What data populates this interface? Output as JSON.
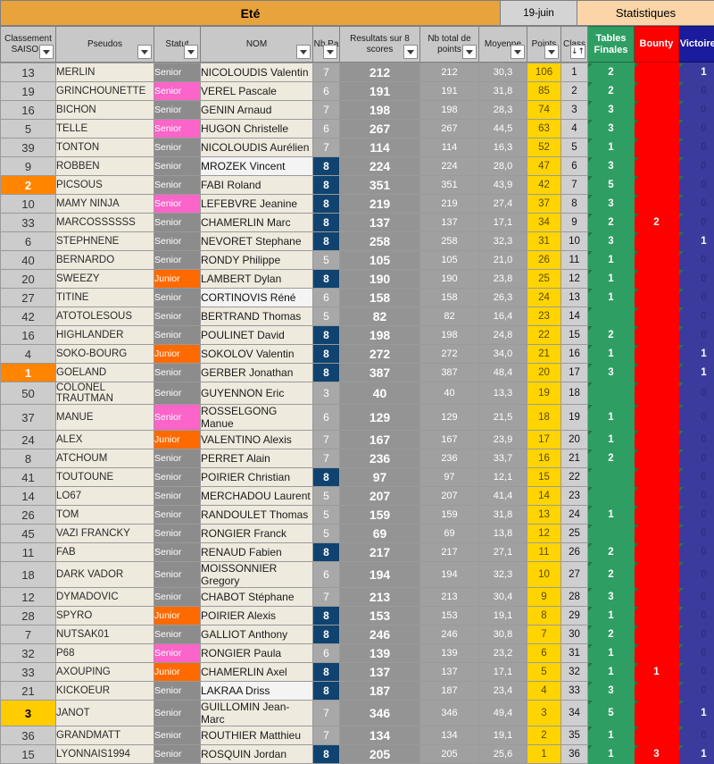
{
  "title_band": {
    "season": "Eté",
    "date": "19-juin",
    "stats": "Statistiques"
  },
  "columns": [
    {
      "key": "rank",
      "label": "Classement SAISON",
      "filter": "dropdown"
    },
    {
      "key": "pseudo",
      "label": "Pseudos",
      "filter": "dropdown"
    },
    {
      "key": "statut",
      "label": "Statut",
      "filter": "dropdown"
    },
    {
      "key": "nom",
      "label": "NOM",
      "filter": "dropdown"
    },
    {
      "key": "nbpa",
      "label": "Nb Pa",
      "filter": "dropdown"
    },
    {
      "key": "res8",
      "label": "Resultats sur 8 scores",
      "filter": "dropdown"
    },
    {
      "key": "nbtot",
      "label": "Nb total de points",
      "filter": "dropdown"
    },
    {
      "key": "moy",
      "label": "Moyenne",
      "filter": "dropdown"
    },
    {
      "key": "points",
      "label": "Points",
      "filter": "dropdown"
    },
    {
      "key": "class",
      "label": "Class",
      "filter": "sort-asc"
    },
    {
      "key": "tf",
      "label": "Tables Finales",
      "filter": "none"
    },
    {
      "key": "bounty",
      "label": "Bounty",
      "filter": "none"
    },
    {
      "key": "vic",
      "label": "Victoire(s)",
      "filter": "none"
    }
  ],
  "icons": {
    "filter_dropdown": "chevron-down-icon",
    "sort_ascending": "sort-ascending-icon",
    "comment_marker": "comment-indicator-icon"
  },
  "colors": {
    "season_band": "#e8a33d",
    "stats_band": "#fbd5a8",
    "tables_finales": "#2e9e63",
    "bounty": "#fe0000",
    "victoires": "#1b1b9e",
    "points": "#ffd400",
    "rank_first": "#ff8400",
    "rank_third": "#ffcc00",
    "statut_pink": "#fb64c8",
    "statut_orange": "#ff6a00",
    "nbpa_full": "#10436f"
  },
  "rows": [
    {
      "rank": "13",
      "rank_style": "none",
      "pseudo": "MERLIN",
      "statut": "Senior",
      "statut_style": "none",
      "nom": "NICOLOUDIS Valentin",
      "nom_style": "cream",
      "nbpa": "7",
      "nbpa_full": false,
      "res8": "212",
      "nbtot": "212",
      "moy": "30,3",
      "points": "106",
      "class": "1",
      "tf": "2",
      "bounty": "",
      "vic": "1"
    },
    {
      "rank": "19",
      "rank_style": "none",
      "pseudo": "GRINCHOUNETTE",
      "statut": "Senior",
      "statut_style": "pink",
      "nom": "VEREL Pascale",
      "nom_style": "cream",
      "nbpa": "6",
      "nbpa_full": false,
      "res8": "191",
      "nbtot": "191",
      "moy": "31,8",
      "points": "85",
      "class": "2",
      "tf": "2",
      "bounty": "",
      "vic": "0"
    },
    {
      "rank": "16",
      "rank_style": "none",
      "pseudo": "BICHON",
      "statut": "Senior",
      "statut_style": "none",
      "nom": "GENIN Arnaud",
      "nom_style": "cream",
      "nbpa": "7",
      "nbpa_full": false,
      "res8": "198",
      "nbtot": "198",
      "moy": "28,3",
      "points": "74",
      "class": "3",
      "tf": "3",
      "bounty": "",
      "vic": "0"
    },
    {
      "rank": "5",
      "rank_style": "none",
      "pseudo": "TELLE",
      "statut": "Senior",
      "statut_style": "pink",
      "nom": "HUGON Christelle",
      "nom_style": "cream",
      "nbpa": "6",
      "nbpa_full": false,
      "res8": "267",
      "nbtot": "267",
      "moy": "44,5",
      "points": "63",
      "class": "4",
      "tf": "3",
      "bounty": "",
      "vic": "0"
    },
    {
      "rank": "39",
      "rank_style": "none",
      "pseudo": "TONTON",
      "statut": "Senior",
      "statut_style": "none",
      "nom": "NICOLOUDIS Aurélien",
      "nom_style": "cream",
      "nbpa": "7",
      "nbpa_full": false,
      "res8": "114",
      "nbtot": "114",
      "moy": "16,3",
      "points": "52",
      "class": "5",
      "tf": "1",
      "bounty": "",
      "vic": "0"
    },
    {
      "rank": "9",
      "rank_style": "none",
      "pseudo": "ROBBEN",
      "statut": "Senior",
      "statut_style": "none",
      "nom": "MROZEK Vincent",
      "nom_style": "lite",
      "nbpa": "8",
      "nbpa_full": true,
      "res8": "224",
      "nbtot": "224",
      "moy": "28,0",
      "points": "47",
      "class": "6",
      "tf": "3",
      "bounty": "",
      "vic": "0"
    },
    {
      "rank": "2",
      "rank_style": "orange",
      "pseudo": "PICSOUS",
      "statut": "Senior",
      "statut_style": "none",
      "nom": "FABI Roland",
      "nom_style": "cream",
      "nbpa": "8",
      "nbpa_full": true,
      "res8": "351",
      "nbtot": "351",
      "moy": "43,9",
      "points": "42",
      "class": "7",
      "tf": "5",
      "bounty": "",
      "vic": "0"
    },
    {
      "rank": "10",
      "rank_style": "none",
      "pseudo": "MAMY NINJA",
      "statut": "Senior",
      "statut_style": "pink",
      "nom": "LEFEBVRE Jeanine",
      "nom_style": "cream",
      "nbpa": "8",
      "nbpa_full": true,
      "res8": "219",
      "nbtot": "219",
      "moy": "27,4",
      "points": "37",
      "class": "8",
      "tf": "3",
      "bounty": "",
      "vic": "0"
    },
    {
      "rank": "33",
      "rank_style": "none",
      "pseudo": "MARCOSSSSSS",
      "statut": "Senior",
      "statut_style": "none",
      "nom": "CHAMERLIN Marc",
      "nom_style": "cream",
      "nbpa": "8",
      "nbpa_full": true,
      "res8": "137",
      "nbtot": "137",
      "moy": "17,1",
      "points": "34",
      "class": "9",
      "tf": "2",
      "bounty": "2",
      "vic": "0"
    },
    {
      "rank": "6",
      "rank_style": "none",
      "pseudo": "STEPHNENE",
      "statut": "Senior",
      "statut_style": "none",
      "nom": "NEVORET Stephane",
      "nom_style": "cream",
      "nbpa": "8",
      "nbpa_full": true,
      "res8": "258",
      "nbtot": "258",
      "moy": "32,3",
      "points": "31",
      "class": "10",
      "tf": "3",
      "bounty": "",
      "vic": "1"
    },
    {
      "rank": "40",
      "rank_style": "none",
      "pseudo": "BERNARDO",
      "statut": "Senior",
      "statut_style": "none",
      "nom": "RONDY Philippe",
      "nom_style": "cream",
      "nbpa": "5",
      "nbpa_full": false,
      "res8": "105",
      "nbtot": "105",
      "moy": "21,0",
      "points": "26",
      "class": "11",
      "tf": "1",
      "bounty": "",
      "vic": "0"
    },
    {
      "rank": "20",
      "rank_style": "none",
      "pseudo": "SWEEZY",
      "statut": "Junior",
      "statut_style": "orange",
      "nom": "LAMBERT Dylan",
      "nom_style": "cream",
      "nbpa": "8",
      "nbpa_full": true,
      "res8": "190",
      "nbtot": "190",
      "moy": "23,8",
      "points": "25",
      "class": "12",
      "tf": "1",
      "bounty": "",
      "vic": "0"
    },
    {
      "rank": "27",
      "rank_style": "none",
      "pseudo": "TITINE",
      "statut": "Senior",
      "statut_style": "none",
      "nom": "CORTINOVIS Réné",
      "nom_style": "lite",
      "nbpa": "6",
      "nbpa_full": false,
      "res8": "158",
      "nbtot": "158",
      "moy": "26,3",
      "points": "24",
      "class": "13",
      "tf": "1",
      "bounty": "",
      "vic": "0"
    },
    {
      "rank": "42",
      "rank_style": "none",
      "pseudo": "ATOTOLESOUS",
      "statut": "Senior",
      "statut_style": "none",
      "nom": "BERTRAND Thomas",
      "nom_style": "cream",
      "nbpa": "5",
      "nbpa_full": false,
      "res8": "82",
      "nbtot": "82",
      "moy": "16,4",
      "points": "23",
      "class": "14",
      "tf": "",
      "bounty": "",
      "vic": "0"
    },
    {
      "rank": "16",
      "rank_style": "none",
      "pseudo": "HIGHLANDER",
      "statut": "Senior",
      "statut_style": "none",
      "nom": "POULINET David",
      "nom_style": "cream",
      "nbpa": "8",
      "nbpa_full": true,
      "res8": "198",
      "nbtot": "198",
      "moy": "24,8",
      "points": "22",
      "class": "15",
      "tf": "2",
      "bounty": "",
      "vic": "0"
    },
    {
      "rank": "4",
      "rank_style": "none",
      "pseudo": "SOKO-BOURG",
      "statut": "Junior",
      "statut_style": "orange",
      "nom": "SOKOLOV Valentin",
      "nom_style": "cream",
      "nbpa": "8",
      "nbpa_full": true,
      "res8": "272",
      "nbtot": "272",
      "moy": "34,0",
      "points": "21",
      "class": "16",
      "tf": "1",
      "bounty": "",
      "vic": "1"
    },
    {
      "rank": "1",
      "rank_style": "orange",
      "pseudo": "GOELAND",
      "statut": "Senior",
      "statut_style": "none",
      "nom": "GERBER Jonathan",
      "nom_style": "cream",
      "nbpa": "8",
      "nbpa_full": true,
      "res8": "387",
      "nbtot": "387",
      "moy": "48,4",
      "points": "20",
      "class": "17",
      "tf": "3",
      "bounty": "",
      "vic": "1"
    },
    {
      "rank": "50",
      "rank_style": "none",
      "pseudo": "COLONEL TRAUTMAN",
      "statut": "Senior",
      "statut_style": "none",
      "nom": "GUYENNON Eric",
      "nom_style": "cream",
      "nbpa": "3",
      "nbpa_full": false,
      "res8": "40",
      "nbtot": "40",
      "moy": "13,3",
      "points": "19",
      "class": "18",
      "tf": "",
      "bounty": "",
      "vic": "0"
    },
    {
      "rank": "37",
      "rank_style": "none",
      "pseudo": "MANUE",
      "statut": "Senior",
      "statut_style": "pink",
      "nom": "ROSSELGONG Manue",
      "nom_style": "cream",
      "nbpa": "6",
      "nbpa_full": false,
      "res8": "129",
      "nbtot": "129",
      "moy": "21,5",
      "points": "18",
      "class": "19",
      "tf": "1",
      "bounty": "",
      "vic": "0"
    },
    {
      "rank": "24",
      "rank_style": "none",
      "pseudo": "ALEX",
      "statut": "Junior",
      "statut_style": "orange",
      "nom": "VALENTINO Alexis",
      "nom_style": "cream",
      "nbpa": "7",
      "nbpa_full": false,
      "res8": "167",
      "nbtot": "167",
      "moy": "23,9",
      "points": "17",
      "class": "20",
      "tf": "1",
      "bounty": "",
      "vic": "0"
    },
    {
      "rank": "8",
      "rank_style": "none",
      "pseudo": "ATCHOUM",
      "statut": "Senior",
      "statut_style": "none",
      "nom": "PERRET Alain",
      "nom_style": "cream",
      "nbpa": "7",
      "nbpa_full": false,
      "res8": "236",
      "nbtot": "236",
      "moy": "33,7",
      "points": "16",
      "class": "21",
      "tf": "2",
      "bounty": "",
      "vic": "0"
    },
    {
      "rank": "41",
      "rank_style": "none",
      "pseudo": "TOUTOUNE",
      "statut": "Senior",
      "statut_style": "none",
      "nom": "POIRIER Christian",
      "nom_style": "cream",
      "nbpa": "8",
      "nbpa_full": true,
      "res8": "97",
      "nbtot": "97",
      "moy": "12,1",
      "points": "15",
      "class": "22",
      "tf": "",
      "bounty": "",
      "vic": "0"
    },
    {
      "rank": "14",
      "rank_style": "none",
      "pseudo": "LO67",
      "statut": "Senior",
      "statut_style": "none",
      "nom": "MERCHADOU Laurent",
      "nom_style": "cream",
      "nbpa": "5",
      "nbpa_full": false,
      "res8": "207",
      "nbtot": "207",
      "moy": "41,4",
      "points": "14",
      "class": "23",
      "tf": "",
      "bounty": "",
      "vic": "0"
    },
    {
      "rank": "26",
      "rank_style": "none",
      "pseudo": "TOM",
      "statut": "Senior",
      "statut_style": "none",
      "nom": "RANDOULET Thomas",
      "nom_style": "cream",
      "nbpa": "5",
      "nbpa_full": false,
      "res8": "159",
      "nbtot": "159",
      "moy": "31,8",
      "points": "13",
      "class": "24",
      "tf": "1",
      "bounty": "",
      "vic": "0"
    },
    {
      "rank": "45",
      "rank_style": "none",
      "pseudo": "VAZI FRANCKY",
      "statut": "Senior",
      "statut_style": "none",
      "nom": "RONGIER Franck",
      "nom_style": "cream",
      "nbpa": "5",
      "nbpa_full": false,
      "res8": "69",
      "nbtot": "69",
      "moy": "13,8",
      "points": "12",
      "class": "25",
      "tf": "",
      "bounty": "",
      "vic": "0"
    },
    {
      "rank": "11",
      "rank_style": "none",
      "pseudo": "FAB",
      "statut": "Senior",
      "statut_style": "none",
      "nom": "RENAUD Fabien",
      "nom_style": "cream",
      "nbpa": "8",
      "nbpa_full": true,
      "res8": "217",
      "nbtot": "217",
      "moy": "27,1",
      "points": "11",
      "class": "26",
      "tf": "2",
      "bounty": "",
      "vic": "0"
    },
    {
      "rank": "18",
      "rank_style": "none",
      "pseudo": "DARK VADOR",
      "statut": "Senior",
      "statut_style": "none",
      "nom": "MOISSONNIER Gregory",
      "nom_style": "cream",
      "nbpa": "6",
      "nbpa_full": false,
      "res8": "194",
      "nbtot": "194",
      "moy": "32,3",
      "points": "10",
      "class": "27",
      "tf": "2",
      "bounty": "",
      "vic": "0"
    },
    {
      "rank": "12",
      "rank_style": "none",
      "pseudo": "DYMADOVIC",
      "statut": "Senior",
      "statut_style": "none",
      "nom": "CHABOT Stéphane",
      "nom_style": "cream",
      "nbpa": "7",
      "nbpa_full": false,
      "res8": "213",
      "nbtot": "213",
      "moy": "30,4",
      "points": "9",
      "class": "28",
      "tf": "3",
      "bounty": "",
      "vic": "0"
    },
    {
      "rank": "28",
      "rank_style": "none",
      "pseudo": "SPYRO",
      "statut": "Junior",
      "statut_style": "orange",
      "nom": "POIRIER Alexis",
      "nom_style": "cream",
      "nbpa": "8",
      "nbpa_full": true,
      "res8": "153",
      "nbtot": "153",
      "moy": "19,1",
      "points": "8",
      "class": "29",
      "tf": "1",
      "bounty": "",
      "vic": "0"
    },
    {
      "rank": "7",
      "rank_style": "none",
      "pseudo": "NUTSAK01",
      "statut": "Senior",
      "statut_style": "none",
      "nom": "GALLIOT Anthony",
      "nom_style": "cream",
      "nbpa": "8",
      "nbpa_full": true,
      "res8": "246",
      "nbtot": "246",
      "moy": "30,8",
      "points": "7",
      "class": "30",
      "tf": "2",
      "bounty": "",
      "vic": "0"
    },
    {
      "rank": "32",
      "rank_style": "none",
      "pseudo": "P68",
      "statut": "Senior",
      "statut_style": "pink",
      "nom": "RONGIER Paula",
      "nom_style": "cream",
      "nbpa": "6",
      "nbpa_full": false,
      "res8": "139",
      "nbtot": "139",
      "moy": "23,2",
      "points": "6",
      "class": "31",
      "tf": "1",
      "bounty": "",
      "vic": "0"
    },
    {
      "rank": "33",
      "rank_style": "none",
      "pseudo": "AXOUPING",
      "statut": "Junior",
      "statut_style": "orange",
      "nom": "CHAMERLIN Axel",
      "nom_style": "cream",
      "nbpa": "8",
      "nbpa_full": true,
      "res8": "137",
      "nbtot": "137",
      "moy": "17,1",
      "points": "5",
      "class": "32",
      "tf": "1",
      "bounty": "1",
      "vic": "0"
    },
    {
      "rank": "21",
      "rank_style": "none",
      "pseudo": "KICKOEUR",
      "statut": "Senior",
      "statut_style": "none",
      "nom": "LAKRAA Driss",
      "nom_style": "lite",
      "nbpa": "8",
      "nbpa_full": true,
      "res8": "187",
      "nbtot": "187",
      "moy": "23,4",
      "points": "4",
      "class": "33",
      "tf": "3",
      "bounty": "",
      "vic": "0"
    },
    {
      "rank": "3",
      "rank_style": "yellow",
      "pseudo": "JANOT",
      "statut": "Senior",
      "statut_style": "none",
      "nom": "GUILLOMIN Jean-Marc",
      "nom_style": "cream",
      "nbpa": "7",
      "nbpa_full": false,
      "res8": "346",
      "nbtot": "346",
      "moy": "49,4",
      "points": "3",
      "class": "34",
      "tf": "5",
      "bounty": "",
      "vic": "1"
    },
    {
      "rank": "36",
      "rank_style": "none",
      "pseudo": "GRANDMATT",
      "statut": "Senior",
      "statut_style": "none",
      "nom": "ROUTHIER Matthieu",
      "nom_style": "cream",
      "nbpa": "7",
      "nbpa_full": false,
      "res8": "134",
      "nbtot": "134",
      "moy": "19,1",
      "points": "2",
      "class": "35",
      "tf": "1",
      "bounty": "",
      "vic": "0"
    },
    {
      "rank": "15",
      "rank_style": "none",
      "pseudo": "LYONNAIS1994",
      "statut": "Senior",
      "statut_style": "none",
      "nom": "ROSQUIN Jordan",
      "nom_style": "cream",
      "nbpa": "8",
      "nbpa_full": true,
      "res8": "205",
      "nbtot": "205",
      "moy": "25,6",
      "points": "1",
      "class": "36",
      "tf": "1",
      "bounty": "3",
      "vic": "1"
    }
  ]
}
